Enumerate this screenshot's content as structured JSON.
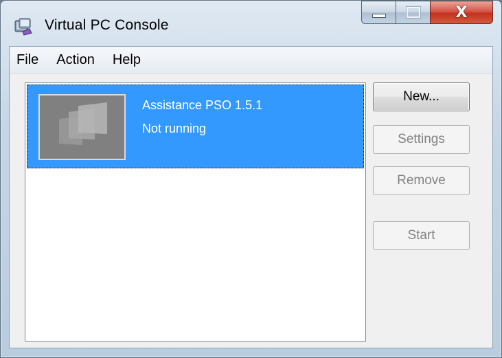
{
  "window": {
    "title": "Virtual PC Console",
    "caption": {
      "minimize": "minimize-icon",
      "maximize": "maximize-icon",
      "close": "close-icon",
      "close_glyph": "X"
    }
  },
  "menu": {
    "items": [
      {
        "label": "File"
      },
      {
        "label": "Action"
      },
      {
        "label": "Help"
      }
    ]
  },
  "vm_list": {
    "items": [
      {
        "name": "Assistance PSO 1.5.1",
        "status": "Not running",
        "selected": true
      }
    ],
    "selection_color": "#3399ff"
  },
  "actions": {
    "new_label": "New...",
    "settings_label": "Settings",
    "remove_label": "Remove",
    "start_label": "Start"
  }
}
